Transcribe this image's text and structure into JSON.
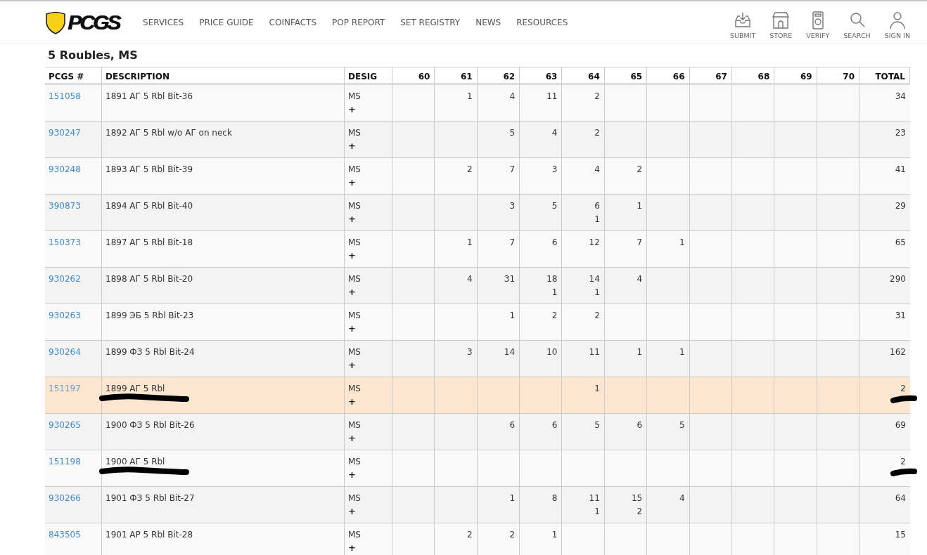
{
  "header": {
    "logo": "PCGS",
    "nav": [
      "SERVICES",
      "PRICE GUIDE",
      "COINFACTS",
      "POP REPORT",
      "SET REGISTRY",
      "NEWS",
      "RESOURCES"
    ],
    "actions": [
      {
        "label": "SUBMIT",
        "kind": "submit"
      },
      {
        "label": "STORE",
        "kind": "store"
      },
      {
        "label": "VERIFY",
        "kind": "verify"
      },
      {
        "label": "SEARCH",
        "kind": "search"
      },
      {
        "label": "SIGN IN",
        "kind": "user"
      }
    ]
  },
  "title": "5 Roubles, MS",
  "table": {
    "columns": [
      "PCGS #",
      "DESCRIPTION",
      "DESIG",
      "60",
      "61",
      "62",
      "63",
      "64",
      "65",
      "66",
      "67",
      "68",
      "69",
      "70",
      "TOTAL"
    ],
    "rows": [
      {
        "pcgs": "151058",
        "description": "1891 АГ 5 Rbl Bit-36",
        "desig": "MS",
        "desig_plus": "+",
        "g61": {
          "n": "1"
        },
        "g62": {
          "n": "4"
        },
        "g63": {
          "n": "11"
        },
        "g64": {
          "n": "2"
        },
        "total": "34",
        "highlighted": false,
        "marked": false
      },
      {
        "pcgs": "930247",
        "description": "1892 АГ 5 Rbl w/o АГ on neck",
        "desig": "MS",
        "desig_plus": "+",
        "g62": {
          "n": "5"
        },
        "g63": {
          "n": "4"
        },
        "g64": {
          "n": "2"
        },
        "total": "23",
        "highlighted": false,
        "marked": false
      },
      {
        "pcgs": "930248",
        "description": "1893 АГ 5 Rbl Bit-39",
        "desig": "MS",
        "desig_plus": "+",
        "g61": {
          "n": "2"
        },
        "g62": {
          "n": "7"
        },
        "g63": {
          "n": "3"
        },
        "g64": {
          "n": "4"
        },
        "g65": {
          "n": "2"
        },
        "total": "41",
        "highlighted": false,
        "marked": false
      },
      {
        "pcgs": "390873",
        "description": "1894 АГ 5 Rbl Bit-40",
        "desig": "MS",
        "desig_plus": "+",
        "g62": {
          "n": "3"
        },
        "g63": {
          "n": "5"
        },
        "g64": {
          "n": "6",
          "plus": "1"
        },
        "g65": {
          "n": "1"
        },
        "total": "29",
        "highlighted": false,
        "marked": false
      },
      {
        "pcgs": "150373",
        "description": "1897 АГ 5 Rbl Bit-18",
        "desig": "MS",
        "desig_plus": "+",
        "g61": {
          "n": "1"
        },
        "g62": {
          "n": "7"
        },
        "g63": {
          "n": "6"
        },
        "g64": {
          "n": "12"
        },
        "g65": {
          "n": "7"
        },
        "g66": {
          "n": "1"
        },
        "total": "65",
        "highlighted": false,
        "marked": false
      },
      {
        "pcgs": "930262",
        "description": "1898 АГ 5 Rbl Bit-20",
        "desig": "MS",
        "desig_plus": "+",
        "g61": {
          "n": "4"
        },
        "g62": {
          "n": "31"
        },
        "g63": {
          "n": "18",
          "plus": "1"
        },
        "g64": {
          "n": "14",
          "plus": "1"
        },
        "g65": {
          "n": "4"
        },
        "total": "290",
        "highlighted": false,
        "marked": false
      },
      {
        "pcgs": "930263",
        "description": "1899 ЭБ 5 Rbl Bit-23",
        "desig": "MS",
        "desig_plus": "+",
        "g62": {
          "n": "1"
        },
        "g63": {
          "n": "2"
        },
        "g64": {
          "n": "2"
        },
        "total": "31",
        "highlighted": false,
        "marked": false
      },
      {
        "pcgs": "930264",
        "description": "1899 ФЗ 5 Rbl Bit-24",
        "desig": "MS",
        "desig_plus": "+",
        "g61": {
          "n": "3"
        },
        "g62": {
          "n": "14"
        },
        "g63": {
          "n": "10"
        },
        "g64": {
          "n": "11"
        },
        "g65": {
          "n": "1"
        },
        "g66": {
          "n": "1"
        },
        "total": "162",
        "highlighted": false,
        "marked": false
      },
      {
        "pcgs": "151197",
        "description": "1899 АГ 5 Rbl",
        "desig": "MS",
        "desig_plus": "+",
        "g64": {
          "n": "1"
        },
        "total": "2",
        "highlighted": true,
        "marked": true
      },
      {
        "pcgs": "930265",
        "description": "1900 ФЗ 5 Rbl Bit-26",
        "desig": "MS",
        "desig_plus": "+",
        "g62": {
          "n": "6"
        },
        "g63": {
          "n": "6"
        },
        "g64": {
          "n": "5"
        },
        "g65": {
          "n": "6"
        },
        "g66": {
          "n": "5"
        },
        "total": "69",
        "highlighted": false,
        "marked": false
      },
      {
        "pcgs": "151198",
        "description": "1900 АГ 5 Rbl",
        "desig": "MS",
        "desig_plus": "+",
        "total": "2",
        "highlighted": false,
        "marked": true
      },
      {
        "pcgs": "930266",
        "description": "1901 ФЗ 5 Rbl Bit-27",
        "desig": "MS",
        "desig_plus": "+",
        "g62": {
          "n": "1"
        },
        "g63": {
          "n": "8"
        },
        "g64": {
          "n": "11",
          "plus": "1"
        },
        "g65": {
          "n": "15",
          "plus": "2"
        },
        "g66": {
          "n": "4"
        },
        "total": "64",
        "highlighted": false,
        "marked": false
      },
      {
        "pcgs": "843505",
        "description": "1901 АР 5 Rbl Bit-28",
        "desig": "MS",
        "desig_plus": "+",
        "g61": {
          "n": "2"
        },
        "g62": {
          "n": "2"
        },
        "g63": {
          "n": "1"
        },
        "total": "15",
        "highlighted": false,
        "marked": false
      }
    ]
  }
}
